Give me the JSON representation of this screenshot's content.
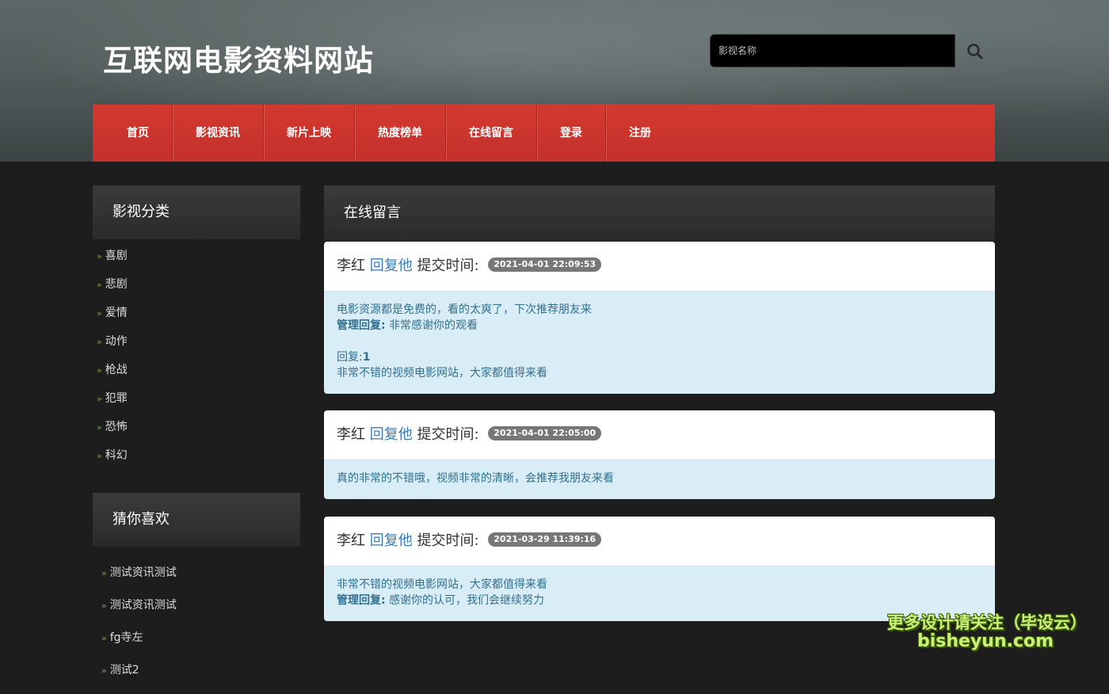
{
  "site": {
    "title": "互联网电影资料网站"
  },
  "search": {
    "placeholder": "影视名称"
  },
  "nav": {
    "items": [
      "首页",
      "影视资讯",
      "新片上映",
      "热度榜单",
      "在线留言",
      "登录",
      "注册"
    ]
  },
  "sidebar": {
    "categories_title": "影视分类",
    "categories": [
      "喜剧",
      "悲剧",
      "爱情",
      "动作",
      "枪战",
      "犯罪",
      "恐怖",
      "科幻"
    ],
    "guess_title": "猜你喜欢",
    "guess": [
      "测试资讯测试",
      "测试资讯测试",
      "fg寺左",
      "测试2"
    ]
  },
  "main": {
    "title": "在线留言",
    "messages": [
      {
        "user": "李红",
        "reply_label": "回复他",
        "time_label": "提交时间:",
        "time": "2021-04-01 22:09:53",
        "content": "电影资源都是免费的，看的太爽了，下次推荐朋友来",
        "admin_label": "管理回复:",
        "admin_reply": "非常感谢你的观看",
        "reply_prefix": "回复:",
        "reply_num": "1",
        "reply_text": "非常不错的视频电影网站，大家都值得来看"
      },
      {
        "user": "李红",
        "reply_label": "回复他",
        "time_label": "提交时间:",
        "time": "2021-04-01 22:05:00",
        "content": "真的非常的不错哦，视频非常的清晰，会推荐我朋友来看"
      },
      {
        "user": "李红",
        "reply_label": "回复他",
        "time_label": "提交时间:",
        "time": "2021-03-29 11:39:16",
        "content": "非常不错的视频电影网站，大家都值得来看",
        "admin_label": "管理回复:",
        "admin_reply": "感谢你的认可，我们会继续努力"
      }
    ]
  },
  "watermark": {
    "line1": "更多设计请关注（毕设云）",
    "line2": "bisheyun.com"
  }
}
